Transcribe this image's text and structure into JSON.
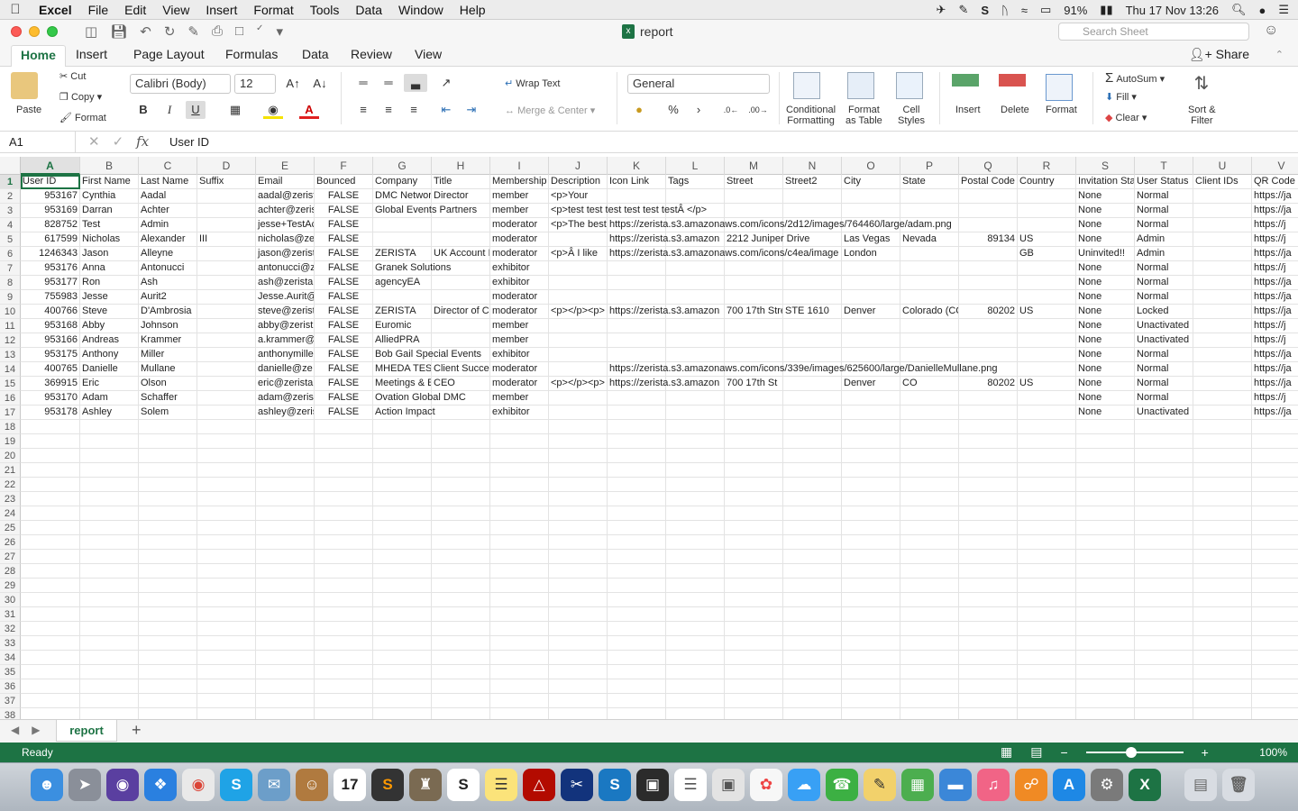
{
  "menubar": {
    "app": "Excel",
    "items": [
      "File",
      "Edit",
      "View",
      "Insert",
      "Format",
      "Tools",
      "Data",
      "Window",
      "Help"
    ],
    "battery": "91%",
    "datetime": "Thu 17 Nov  13:26"
  },
  "window": {
    "title": "report",
    "search_placeholder": "Search Sheet"
  },
  "ribbon_tabs": [
    "Home",
    "Insert",
    "Page Layout",
    "Formulas",
    "Data",
    "Review",
    "View"
  ],
  "share_label": "Share",
  "ribbon": {
    "paste": "Paste",
    "cut": "Cut",
    "copy": "Copy",
    "format_painter": "Format",
    "font_name": "Calibri (Body)",
    "font_size": "12",
    "bold": "B",
    "italic": "I",
    "underline": "U",
    "wrap_text": "Wrap Text",
    "merge_center": "Merge & Center",
    "number_format": "General",
    "percent": "%",
    "comma": "›",
    "conditional_formatting": [
      "Conditional",
      "Formatting"
    ],
    "format_as_table": [
      "Format",
      "as Table"
    ],
    "cell_styles": [
      "Cell",
      "Styles"
    ],
    "insert": "Insert",
    "delete": "Delete",
    "format": "Format",
    "autosum": "AutoSum",
    "fill": "Fill",
    "clear": "Clear",
    "sort_filter": [
      "Sort &",
      "Filter"
    ]
  },
  "formula_bar": {
    "name_box": "A1",
    "fx": "fx",
    "content": "User ID"
  },
  "columns": [
    "A",
    "B",
    "C",
    "D",
    "E",
    "F",
    "G",
    "H",
    "I",
    "J",
    "K",
    "L",
    "M",
    "N",
    "O",
    "P",
    "Q",
    "R",
    "S",
    "T",
    "U",
    "V"
  ],
  "rows": [
    [
      "User ID",
      "First Name",
      "Last Name",
      "Suffix",
      "Email",
      "Bounced",
      "Company",
      "Title",
      "Membership",
      "Description",
      "Icon Link",
      "Tags",
      "Street",
      "Street2",
      "City",
      "State",
      "Postal Code",
      "Country",
      "Invitation Sta",
      "User Status",
      "Client IDs",
      "QR Code"
    ],
    [
      "953167",
      "Cynthia",
      "Aadal",
      "",
      "aadal@zerist",
      "FALSE",
      "DMC Networ",
      "Director",
      "member",
      "<p>Your",
      "",
      "",
      "",
      "",
      "",
      "",
      "",
      "",
      "None",
      "Normal",
      "",
      "https://ja"
    ],
    [
      "953169",
      "Darran",
      "Achter",
      "",
      "achter@zeris",
      "FALSE",
      "Global Events Partners",
      "",
      "member",
      "<p>test test test test test testÂ </p>",
      "",
      "",
      "",
      "",
      "",
      "",
      "",
      "",
      "None",
      "Normal",
      "",
      "https://ja"
    ],
    [
      "828752",
      "Test",
      "Admin",
      "",
      "jesse+TestAc",
      "FALSE",
      "",
      "",
      "moderator",
      "<p>The best",
      "https://zerista.s3.amazonaws.com/icons/2d12/images/764460/large/adam.png",
      "",
      "",
      "",
      "",
      "",
      "",
      "",
      "None",
      "Normal",
      "",
      "https://j"
    ],
    [
      "617599",
      "Nicholas",
      "Alexander",
      "III",
      "nicholas@ze",
      "FALSE",
      "",
      "",
      "moderator",
      "",
      "https://zerista.s3.amazon",
      "",
      "2212 Juniper Drive",
      "",
      "Las Vegas",
      "Nevada",
      "89134",
      "US",
      "None",
      "Admin",
      "",
      "https://j"
    ],
    [
      "1246343",
      "Jason",
      "Alleyne",
      "",
      "jason@zerist",
      "FALSE",
      "ZERISTA",
      "UK Account I",
      "moderator",
      "<p>Â I like",
      "https://zerista.s3.amazonaws.com/icons/c4ea/image",
      "",
      "",
      "",
      "London",
      "",
      "",
      "GB",
      "Uninvited!!",
      "Admin",
      "",
      "https://ja"
    ],
    [
      "953176",
      "Anna",
      "Antonucci",
      "",
      "antonucci@z",
      "FALSE",
      "Granek Solutions",
      "",
      "exhibitor",
      "",
      "",
      "",
      "",
      "",
      "",
      "",
      "",
      "",
      "None",
      "Normal",
      "",
      "https://j"
    ],
    [
      "953177",
      "Ron",
      "Ash",
      "",
      "ash@zerista.",
      "FALSE",
      "agencyEA",
      "",
      "exhibitor",
      "",
      "",
      "",
      "",
      "",
      "",
      "",
      "",
      "",
      "None",
      "Normal",
      "",
      "https://ja"
    ],
    [
      "755983",
      "Jesse",
      "Aurit2",
      "",
      "Jesse.Aurit@",
      "FALSE",
      "",
      "",
      "moderator",
      "",
      "",
      "",
      "",
      "",
      "",
      "",
      "",
      "",
      "None",
      "Normal",
      "",
      "https://ja"
    ],
    [
      "400766",
      "Steve",
      "D'Ambrosia",
      "",
      "steve@zerist",
      "FALSE",
      "ZERISTA",
      "Director of C",
      "moderator",
      "<p></p><p>",
      "https://zerista.s3.amazon",
      "",
      "700 17th Stre",
      "STE 1610",
      "Denver",
      "Colorado (CC",
      "80202",
      "US",
      "None",
      "Locked",
      "",
      "https://ja"
    ],
    [
      "953168",
      "Abby",
      "Johnson",
      "",
      "abby@zerist",
      "FALSE",
      "Euromic",
      "",
      "member",
      "",
      "",
      "",
      "",
      "",
      "",
      "",
      "",
      "",
      "None",
      "Unactivated",
      "",
      "https://j"
    ],
    [
      "953166",
      "Andreas",
      "Krammer",
      "",
      "a.krammer@",
      "FALSE",
      "AlliedPRA",
      "",
      "member",
      "",
      "",
      "",
      "",
      "",
      "",
      "",
      "",
      "",
      "None",
      "Unactivated",
      "",
      "https://j"
    ],
    [
      "953175",
      "Anthony",
      "Miller",
      "",
      "anthonymille",
      "FALSE",
      "Bob Gail Special Events",
      "",
      "exhibitor",
      "",
      "",
      "",
      "",
      "",
      "",
      "",
      "",
      "",
      "None",
      "Normal",
      "",
      "https://ja"
    ],
    [
      "400765",
      "Danielle",
      "Mullane",
      "",
      "danielle@ze",
      "FALSE",
      "MHEDA TEST",
      "Client Succes",
      "moderator",
      "",
      "https://zerista.s3.amazonaws.com/icons/339e/images/625600/large/DanielleMullane.png",
      "",
      "",
      "",
      "",
      "",
      "",
      "",
      "None",
      "Normal",
      "",
      "https://ja"
    ],
    [
      "369915",
      "Eric",
      "Olson",
      "",
      "eric@zerista.",
      "FALSE",
      "Meetings & E",
      "CEO",
      "moderator",
      "<p></p><p>",
      "https://zerista.s3.amazon",
      "",
      "700 17th St",
      "",
      "Denver",
      "CO",
      "80202",
      "US",
      "None",
      "Normal",
      "",
      "https://ja"
    ],
    [
      "953170",
      "Adam",
      "Schaffer",
      "",
      "adam@zerist",
      "FALSE",
      "Ovation Global DMC",
      "",
      "member",
      "",
      "",
      "",
      "",
      "",
      "",
      "",
      "",
      "",
      "None",
      "Normal",
      "",
      "https://j"
    ],
    [
      "953178",
      "Ashley",
      "Solem",
      "",
      "ashley@zeris",
      "FALSE",
      "Action Impact",
      "",
      "exhibitor",
      "",
      "",
      "",
      "",
      "",
      "",
      "",
      "",
      "",
      "None",
      "Unactivated",
      "",
      "https://ja"
    ]
  ],
  "sheet_tabs": [
    "report"
  ],
  "status": {
    "text": "Ready",
    "zoom": "100%"
  }
}
